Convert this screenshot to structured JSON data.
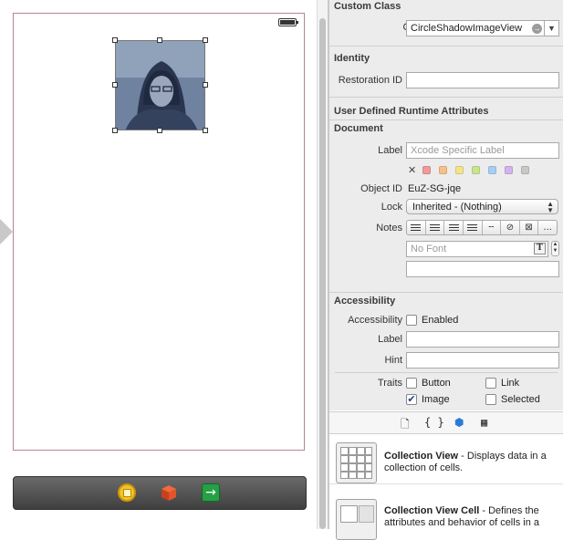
{
  "inspector": {
    "custom_class": {
      "title": "Custom Class",
      "class_label": "Class",
      "class_value": "CircleShadowImageView"
    },
    "identity": {
      "title": "Identity",
      "restoration_id_label": "Restoration ID",
      "restoration_id_value": ""
    },
    "runtime_attributes": {
      "title": "User Defined Runtime Attributes"
    },
    "document": {
      "title": "Document",
      "label_label": "Label",
      "label_placeholder": "Xcode Specific Label",
      "label_colors": [
        "#f19a9a",
        "#f6c08a",
        "#f3e48a",
        "#c9e38f",
        "#a9cdf2",
        "#d6b2ea",
        "#c8c8c8"
      ],
      "object_id_label": "Object ID",
      "object_id_value": "EuZ-SG-jqe",
      "lock_label": "Lock",
      "lock_value": "Inherited - (Nothing)",
      "notes_label": "Notes",
      "font_placeholder": "No Font",
      "font_button": "T",
      "more_label": "..."
    },
    "accessibility": {
      "title": "Accessibility",
      "accessibility_label": "Accessibility",
      "enabled_label": "Enabled",
      "enabled_checked": false,
      "label_label": "Label",
      "hint_label": "Hint",
      "traits_label": "Traits",
      "traits": [
        {
          "label": "Button",
          "checked": false
        },
        {
          "label": "Link",
          "checked": false
        },
        {
          "label": "Image",
          "checked": true
        },
        {
          "label": "Selected",
          "checked": false
        }
      ]
    }
  },
  "library": {
    "tabs": [
      {
        "icon": "file-template-icon",
        "glyph": "🗋"
      },
      {
        "icon": "code-snippet-icon",
        "glyph": "{ }"
      },
      {
        "icon": "object-library-icon",
        "glyph": "⬢"
      },
      {
        "icon": "media-library-icon",
        "glyph": "▦"
      }
    ],
    "items": [
      {
        "name": "Collection View",
        "desc": " - Displays data in a collection of cells."
      },
      {
        "name": "Collection View Cell",
        "desc": " - Defines the attributes and behavior of cells in a"
      }
    ]
  },
  "canvas": {
    "dock_icons": [
      "view-controller-icon",
      "first-responder-cube-icon",
      "exit-icon"
    ]
  }
}
